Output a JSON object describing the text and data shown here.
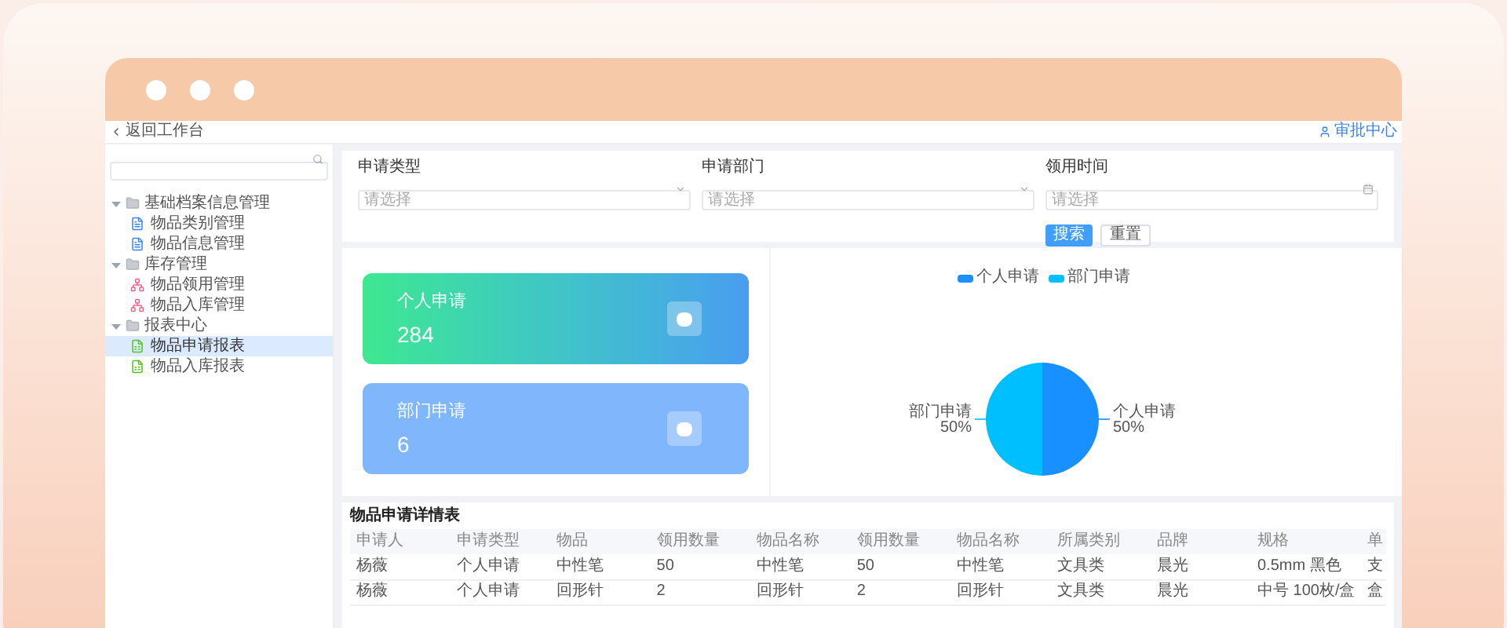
{
  "topbar": {
    "back": "返回工作台",
    "approval": "审批中心"
  },
  "sidebar": {
    "items": [
      {
        "label": "基础档案信息管理",
        "expanded": true,
        "children": [
          {
            "label": "物品类别管理",
            "kind": "doc",
            "selected": false
          },
          {
            "label": "物品信息管理",
            "kind": "doc",
            "selected": false
          }
        ]
      },
      {
        "label": "库存管理",
        "expanded": true,
        "children": [
          {
            "label": "物品领用管理",
            "kind": "tree",
            "selected": false
          },
          {
            "label": "物品入库管理",
            "kind": "tree",
            "selected": false
          }
        ]
      },
      {
        "label": "报表中心",
        "expanded": true,
        "children": [
          {
            "label": "物品申请报表",
            "kind": "sheet",
            "selected": true
          },
          {
            "label": "物品入库报表",
            "kind": "sheet",
            "selected": false
          }
        ]
      }
    ]
  },
  "filters": [
    {
      "label": "申请类型",
      "placeholder": "请选择",
      "kind": "select"
    },
    {
      "label": "申请部门",
      "placeholder": "请选择",
      "kind": "select"
    },
    {
      "label": "领用时间",
      "placeholder": "请选择",
      "kind": "date"
    }
  ],
  "buttons": [
    {
      "label": "搜索",
      "kind": "primary"
    },
    {
      "label": "重置",
      "kind": "plain"
    }
  ],
  "cards": [
    {
      "title": "个人申请",
      "value": "284",
      "kind": "gradient"
    },
    {
      "title": "部门申请",
      "value": "6",
      "kind": "light"
    }
  ],
  "chart": {
    "chart_data": {
      "type": "pie",
      "categories": [
        "个人申请",
        "部门申请"
      ],
      "series": [
        {
          "values": [
            50,
            50
          ]
        }
      ],
      "colors": [
        "#1890ff",
        "#00bfff"
      ],
      "legend": "top",
      "value_labels": [
        "50%",
        "50%"
      ]
    }
  },
  "table": {
    "title": "物品申请详情表",
    "columns": [
      "申请人",
      "申请类型",
      "物品",
      "领用数量",
      "物品名称",
      "领用数量",
      "物品名称",
      "所属类别",
      "品牌",
      "规格",
      "单"
    ],
    "rows": [
      [
        "杨薇",
        "个人申请",
        "中性笔",
        "50",
        "中性笔",
        "50",
        "中性笔",
        "文具类",
        "晨光",
        "0.5mm 黑色",
        "支"
      ],
      [
        "杨薇",
        "个人申请",
        "回形针",
        "2",
        "回形针",
        "2",
        "回形针",
        "文具类",
        "晨光",
        "中号 100枚/盒",
        "盒"
      ]
    ]
  }
}
